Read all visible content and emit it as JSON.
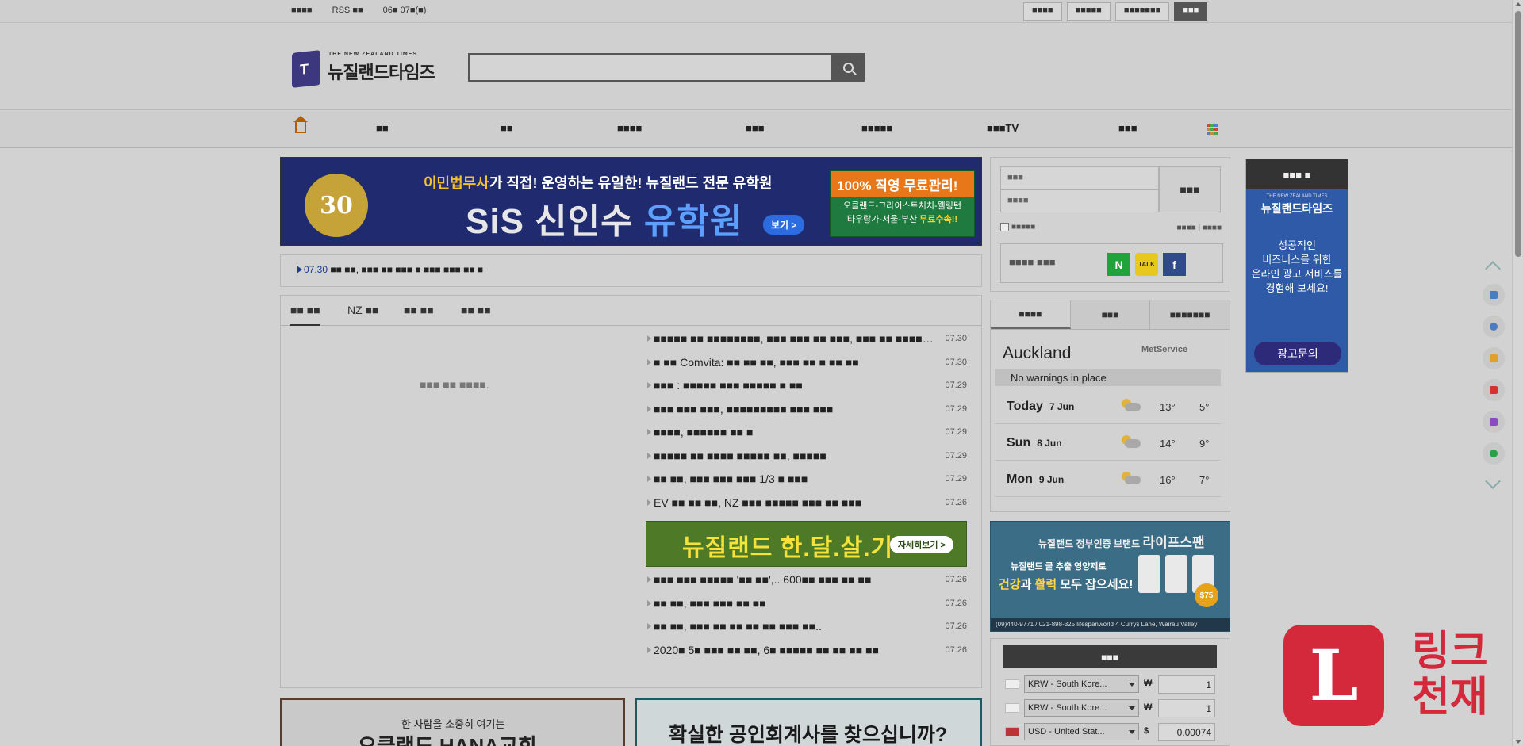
{
  "topbar": {
    "left": [
      "■■■■",
      "RSS ■■",
      "06■ 07■(■)"
    ],
    "right": [
      "■■■■",
      "■■■■■",
      "■■■■■■■",
      "■■■"
    ]
  },
  "header": {
    "logo_small": "THE NEW ZEALAND TIMES",
    "logo_big": "뉴질랜드타임즈",
    "search_placeholder": ""
  },
  "nav": {
    "items": [
      "■■",
      "■■",
      "■■■■",
      "■■■",
      "■■■■■",
      "■■■TV",
      "■■■"
    ]
  },
  "top_banner": {
    "line1_hl": "이민법무사",
    "line1_rest": "가 직접! 운영하는 유일한! 뉴질랜드 전문 유학원",
    "title_a": "SiS 신인수 ",
    "title_b": "유학원",
    "see": "보기 >",
    "badge": "30",
    "promo_head": "100% 직영 무료관리!",
    "promo_l1": "오클랜드-크라이스트처치-웰링턴",
    "promo_l2a": "타우랑가-서울-부산 ",
    "promo_l2b": "무료수속!!"
  },
  "ticker": {
    "date": "07.30",
    "text": "■■ ■■, ■■■ ■■ ■■■ ■ ■■■ ■■■ ■■ ■"
  },
  "news": {
    "tabs": [
      "■■ ■■",
      "NZ ■■",
      "■■ ■■",
      "■■ ■■"
    ],
    "no_image": "■■■ ■■ ■■■■.",
    "items_top": [
      {
        "title": "■■■■■ ■■ ■■■■■■■■, ■■■ ■■■ ■■ ■■■, ■■■ ■■ ■■■■■■",
        "date": "07.30"
      },
      {
        "title": "■ ■■ Comvita: ■■ ■■ ■■, ■■■ ■■ ■ ■■ ■■",
        "date": "07.30"
      },
      {
        "title": "■■■ : ■■■■■ ■■■ ■■■■■ ■ ■■",
        "date": "07.29"
      },
      {
        "title": "■■■ ■■■ ■■■, ■■■■■■■■■ ■■■ ■■■",
        "date": "07.29"
      },
      {
        "title": "■■■■, ■■■■■■ ■■ ■",
        "date": "07.29"
      },
      {
        "title": "■■■■■ ■■ ■■■■ ■■■■■ ■■, ■■■■■",
        "date": "07.29"
      },
      {
        "title": "■■ ■■, ■■■ ■■■ ■■■ 1/3 ■ ■■■",
        "date": "07.29"
      },
      {
        "title": "EV ■■ ■■ ■■, NZ ■■■ ■■■■■ ■■■ ■■ ■■■",
        "date": "07.26"
      }
    ],
    "mid_banner": "뉴질랜드 한.달.살.기",
    "mid_banner_btn": "자세히보기 >",
    "items_bottom": [
      {
        "title": "■■■ ■■■ ■■■■■ '■■ ■■',.. 600■■ ■■■ ■■ ■■",
        "date": "07.26"
      },
      {
        "title": "■■ ■■, ■■■ ■■■ ■■ ■■",
        "date": "07.26"
      },
      {
        "title": "■■ ■■, ■■■ ■■ ■■ ■■ ■■ ■■■ ■■..",
        "date": "07.26"
      },
      {
        "title": "2020■ 5■ ■■■ ■■ ■■, 6■ ■■■■■ ■■ ■■ ■■ ■■",
        "date": "07.26"
      }
    ]
  },
  "bottom_banners": {
    "b1_small": "한 사람을 소중히 여기는",
    "b1_big": "오클랜드 HANA교회",
    "b2": "확실한 공인회계사를 찾으십니까?"
  },
  "login": {
    "id_placeholder": "■■■",
    "pw_placeholder": "■■■■",
    "button": "■■■",
    "auto": "■■■■■",
    "links": "■■■■ | ■■■■",
    "social_label": "■■■■ ■■■",
    "naver": "N",
    "kakao": "TALK",
    "facebook": "f"
  },
  "weather": {
    "tabs": [
      "■■■■",
      "■■■",
      "■■■■■■■"
    ],
    "city": "Auckland",
    "provider": "MetService",
    "warning": "No warnings in place",
    "days": [
      {
        "day": "Today",
        "date": "7 Jun",
        "hi": "13°",
        "lo": "5°"
      },
      {
        "day": "Sun",
        "date": "8 Jun",
        "hi": "14°",
        "lo": "9°"
      },
      {
        "day": "Mon",
        "date": "9 Jun",
        "hi": "16°",
        "lo": "7°"
      }
    ]
  },
  "life_banner": {
    "head_a": "뉴질랜드 정부인증 브랜드 ",
    "head_b": "라이프스팬",
    "sub1": "뉴질랜드 굴 추출 영양제로",
    "sub2a": "건강",
    "sub2b": "과 ",
    "sub2c": "활력",
    "sub2d": " 모두 잡으세요!",
    "price": "$75",
    "foot": "(09)440-9771 / 021-898-325  lifespanworld  4 Currys Lane, Wairau Valley"
  },
  "exchange": {
    "title": "■■■",
    "rows": [
      {
        "currency": "KRW - South Kore...",
        "symbol": "₩",
        "value": "1"
      },
      {
        "currency": "KRW - South Kore...",
        "symbol": "₩",
        "value": "1"
      },
      {
        "currency": "USD - United Stat...",
        "symbol": "$",
        "value": "0.00074"
      }
    ]
  },
  "side_ad": {
    "head": "■■■ ■",
    "brand_small": "THE NEW ZEALAND TIMES",
    "brand": "뉴질랜드타임즈",
    "l1": "성공적인",
    "l2": "비즈니스를 위한",
    "l3": "온라인 광고 서비스를",
    "l4": "경험해 보세요!",
    "cta": "광고문의"
  },
  "watermark": {
    "letter": "L",
    "line1": "링크",
    "line2": "천재"
  },
  "colors": {
    "brand": "#3d3780",
    "overlay_gray": "#d2d2d2",
    "watermark_red": "#d4293b"
  }
}
